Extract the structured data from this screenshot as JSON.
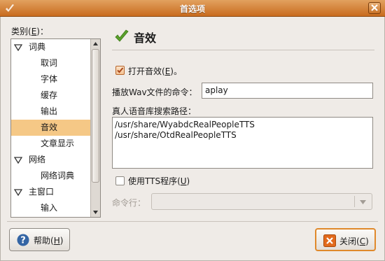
{
  "window": {
    "title": "首选项"
  },
  "category": {
    "label": "类别(",
    "mnemonic": "E",
    "suffix": ")："
  },
  "tree": {
    "items": [
      {
        "label": "词典",
        "level": 0,
        "expanded": true
      },
      {
        "label": "取词",
        "level": 1
      },
      {
        "label": "字体",
        "level": 1
      },
      {
        "label": "缓存",
        "level": 1
      },
      {
        "label": "输出",
        "level": 1
      },
      {
        "label": "音效",
        "level": 1,
        "selected": true
      },
      {
        "label": "文章显示",
        "level": 1
      },
      {
        "label": "网络",
        "level": 0,
        "expanded": true
      },
      {
        "label": "网络词典",
        "level": 1
      },
      {
        "label": "主窗口",
        "level": 0,
        "expanded": true
      },
      {
        "label": "输入",
        "level": 1
      }
    ]
  },
  "section": {
    "title": "音效",
    "icon": "checkmark-icon"
  },
  "enable_sound": {
    "label": "打开音效(",
    "mnemonic": "E",
    "suffix": ")。",
    "checked": true
  },
  "wav_command": {
    "label": "播放Wav文件的命令：",
    "value": "aplay"
  },
  "tts_path": {
    "label": "真人语音库搜索路径：",
    "lines": [
      "/usr/share/WyabdcRealPeopleTTS",
      "/usr/share/OtdRealPeopleTTS"
    ]
  },
  "use_tts": {
    "label": "使用TTS程序(",
    "mnemonic": "U",
    "suffix": ")",
    "checked": false
  },
  "command_line": {
    "label": "命令行：",
    "value": ""
  },
  "buttons": {
    "help": {
      "label": "帮助(",
      "mnemonic": "H",
      "suffix": ")"
    },
    "close": {
      "label": "关闭(",
      "mnemonic": "C",
      "suffix": ")"
    }
  },
  "colors": {
    "titlebar": "#c86b1e",
    "selection": "#f5c886",
    "focus": "#e0892b",
    "check": "#5aa02c"
  }
}
